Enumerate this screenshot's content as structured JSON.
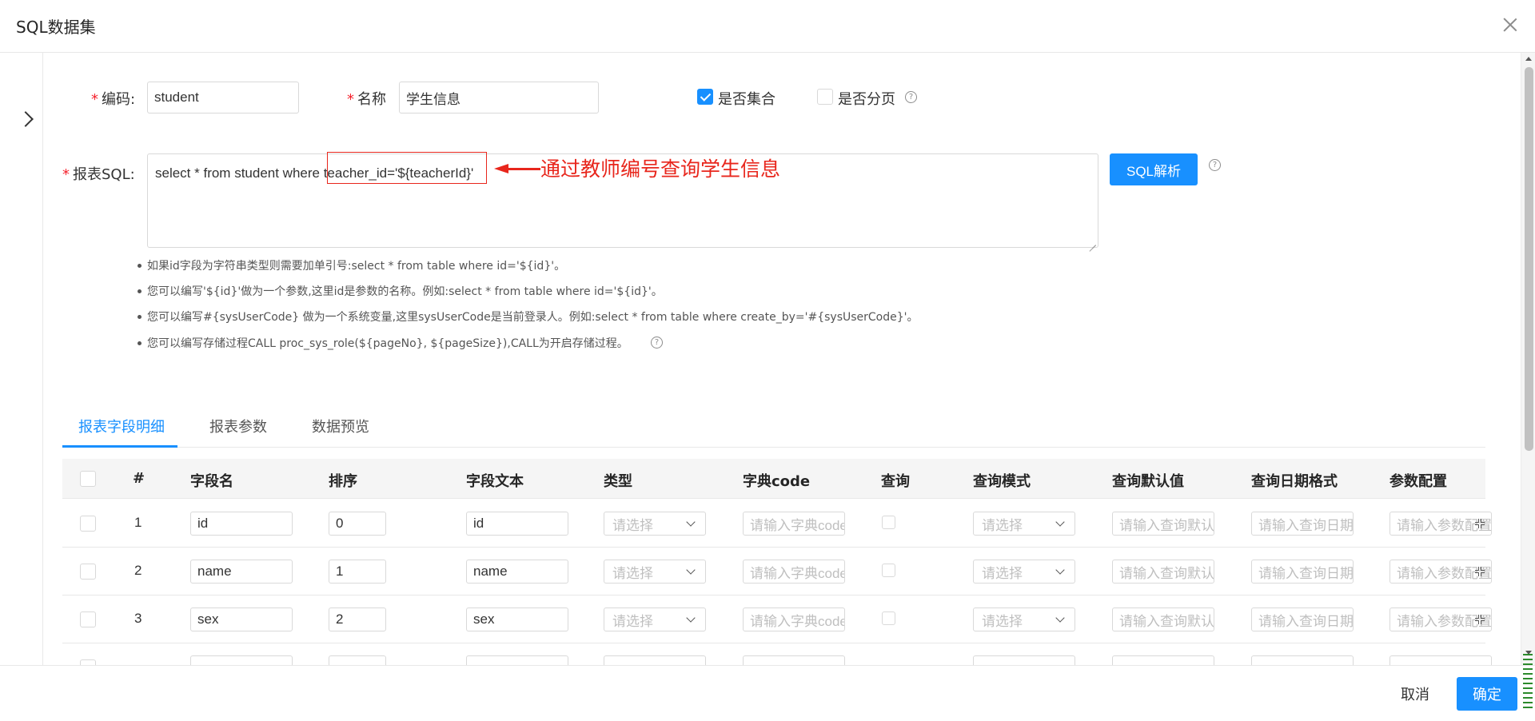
{
  "dialog": {
    "title": "SQL数据集"
  },
  "form": {
    "code": {
      "label": "编码:",
      "value": "student"
    },
    "name": {
      "label": "名称",
      "value": "学生信息"
    },
    "is_collection": {
      "label": "是否集合",
      "checked": true
    },
    "is_paged": {
      "label": "是否分页",
      "checked": false
    },
    "sql": {
      "label": "报表SQL:",
      "value": "select * from student where teacher_id='${teacherId}'"
    },
    "parse_button": "SQL解析"
  },
  "annotation": {
    "text": "通过教师编号查询学生信息",
    "color": "#e8261c"
  },
  "tips": [
    "如果id字段为字符串类型则需要加单引号:select * from table where id='${id}'。",
    "您可以编写'${id}'做为一个参数,这里id是参数的名称。例如:select * from table where id='${id}'。",
    "您可以编写#{sysUserCode} 做为一个系统变量,这里sysUserCode是当前登录人。例如:select * from table where create_by='#{sysUserCode}'。",
    "您可以编写存储过程CALL proc_sys_role(${pageNo}, ${pageSize}),CALL为开启存储过程。"
  ],
  "tabs": [
    {
      "label": "报表字段明细",
      "active": true
    },
    {
      "label": "报表参数",
      "active": false
    },
    {
      "label": "数据预览",
      "active": false
    }
  ],
  "table": {
    "headers": [
      "#",
      "字段名",
      "排序",
      "字段文本",
      "类型",
      "字典code",
      "查询",
      "查询模式",
      "查询默认值",
      "查询日期格式",
      "参数配置"
    ],
    "placeholders": {
      "type": "请选择",
      "dict_code": "请输入字典code",
      "query_mode": "请选择",
      "query_default": "请输入查询默认值",
      "query_date_format": "请输入查询日期格式",
      "param_config": "请输入参数配置"
    },
    "rows": [
      {
        "num": "1",
        "field": "id",
        "order": "0",
        "text": "id"
      },
      {
        "num": "2",
        "field": "name",
        "order": "1",
        "text": "name"
      },
      {
        "num": "3",
        "field": "sex",
        "order": "2",
        "text": "sex"
      }
    ]
  },
  "footer": {
    "cancel": "取消",
    "ok": "确定"
  },
  "colors": {
    "primary": "#1890ff",
    "required": "#f5222d",
    "annotation": "#e8261c"
  }
}
